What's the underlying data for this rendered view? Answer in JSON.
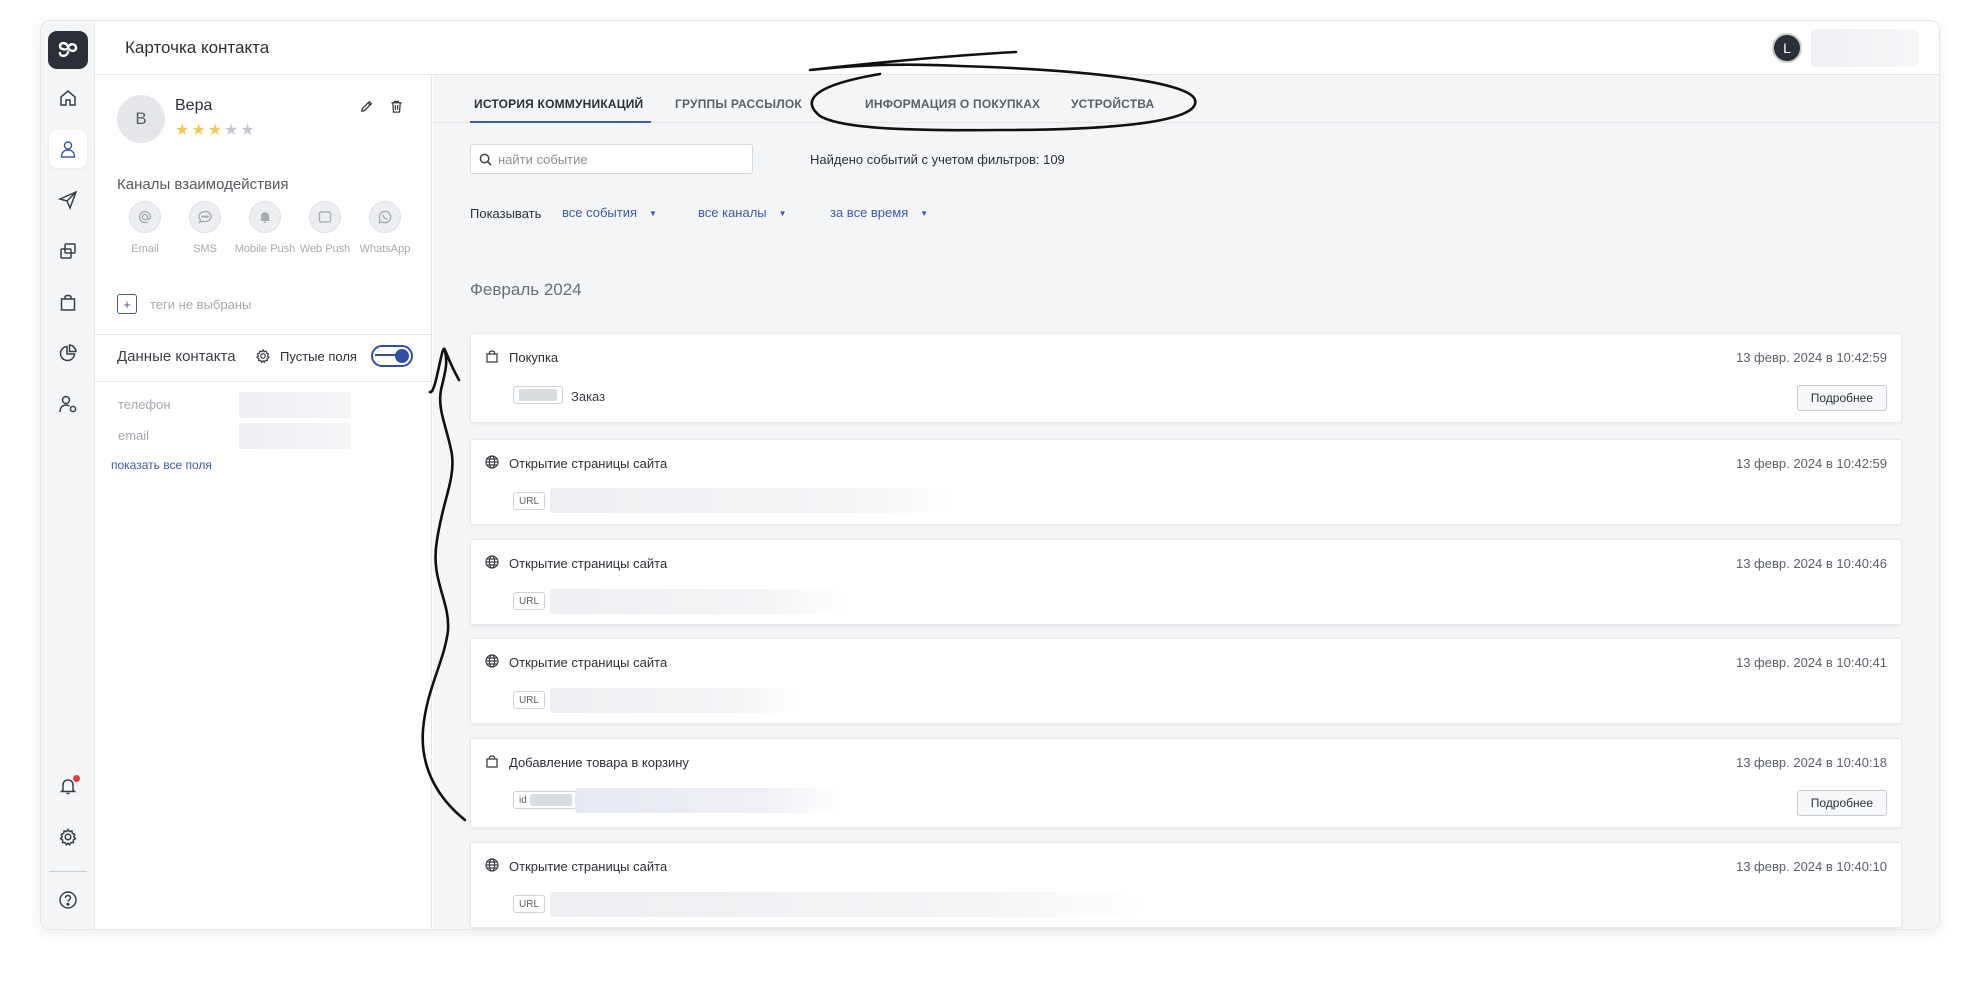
{
  "header": {
    "title": "Карточка контакта",
    "user_initial": "L"
  },
  "contact": {
    "avatar_letter": "В",
    "name": "Вера",
    "rating": 3,
    "rating_max": 5,
    "channels_title": "Каналы взаимодействия",
    "channels": [
      {
        "label": "Email",
        "icon": "at-icon"
      },
      {
        "label": "SMS",
        "icon": "chat-icon"
      },
      {
        "label": "Mobile Push",
        "icon": "bell-icon"
      },
      {
        "label": "Web Push",
        "icon": "browser-icon"
      },
      {
        "label": "WhatsApp",
        "icon": "whatsapp-icon"
      }
    ],
    "tags_add": "+",
    "tags_empty": "теги не выбраны",
    "data_title": "Данные контакта",
    "empty_fields_label": "Пустые поля",
    "empty_fields_on": true,
    "fields": [
      {
        "label": "телефон"
      },
      {
        "label": "email"
      }
    ],
    "show_all": "показать все поля"
  },
  "tabs": [
    {
      "label": "ИСТОРИЯ КОММУНИКАЦИЙ",
      "active": true
    },
    {
      "label": "ГРУППЫ РАССЫЛОК",
      "active": false
    },
    {
      "label": "ИНФОРМАЦИЯ О ПОКУПКАХ",
      "active": false
    },
    {
      "label": "УСТРОЙСТВА",
      "active": false
    }
  ],
  "search": {
    "placeholder": "найти событие",
    "value": ""
  },
  "found_text": "Найдено событий с учетом фильтров: 109",
  "filters": {
    "label": "Показывать",
    "events": "все события",
    "channels": "все каналы",
    "period": "за все время"
  },
  "month": "Февраль 2024",
  "events": [
    {
      "title": "Покупка",
      "time": "13 февр. 2024 в 10:42:59",
      "icon": "bag-icon",
      "text": "Заказ",
      "button": "Подробнее"
    },
    {
      "title": "Открытие страницы сайта",
      "time": "13 февр. 2024 в 10:42:59",
      "icon": "globe-icon",
      "badge": "URL"
    },
    {
      "title": "Открытие страницы сайта",
      "time": "13 февр. 2024 в 10:40:46",
      "icon": "globe-icon",
      "badge": "URL"
    },
    {
      "title": "Открытие страницы сайта",
      "time": "13 февр. 2024 в 10:40:41",
      "icon": "globe-icon",
      "badge": "URL"
    },
    {
      "title": "Добавление товара в корзину",
      "time": "13 февр. 2024 в 10:40:18",
      "icon": "bag-icon",
      "badge": "id",
      "button": "Подробнее"
    },
    {
      "title": "Открытие страницы сайта",
      "time": "13 февр. 2024 в 10:40:10",
      "icon": "globe-icon",
      "badge": "URL"
    }
  ],
  "colors": {
    "accent": "#3b5bab",
    "star": "#f2c94c",
    "rail_bg": "#f4f5f7",
    "notification": "#e53935"
  }
}
